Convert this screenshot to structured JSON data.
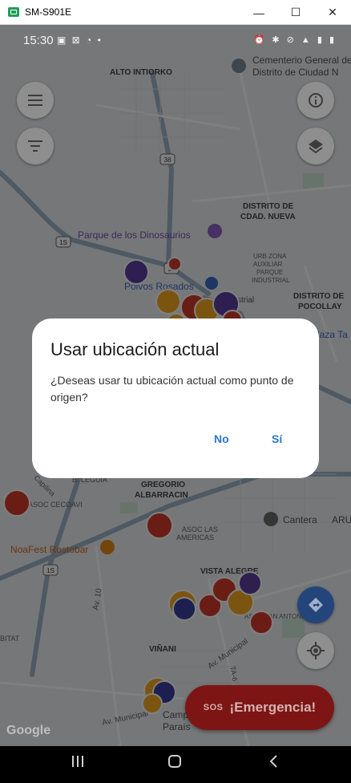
{
  "window": {
    "title": "SM-S901E",
    "minimize": "—",
    "maximize": "☐",
    "close": "✕"
  },
  "status_bar": {
    "time": "15:30",
    "left_icons": "▣ ⊠ ◔ •",
    "right_icons": "⏰ ✱ ⊘ ▲ ▮ ▮"
  },
  "map_labels": {
    "cementerio": "Cementerio General de",
    "cementerio2": "Distrito de Ciudad N",
    "alto_intiorko": "ALTO INTIORKO",
    "distrito_cdad_nueva1": "DISTRITO DE",
    "distrito_cdad_nueva2": "CDAD. NUEVA",
    "parque": "Parque de los Dinosaurios",
    "polvos_rosados": "Polvos Rosados",
    "urb1": "URB ZONA",
    "urb2": "AUXILIAR",
    "urb3": "PARQUE",
    "urb4": "INDUSTRIAL",
    "pocollay1": "DISTRITO DE",
    "pocollay2": "POCOLLAY",
    "plaza": "laza Ta",
    "striar": "strial",
    "gregorio1": "GREGORIO",
    "gregorio2": "ALBARRACIN",
    "cantera": "Cantera",
    "aru": "ARU",
    "asoc_cecoavi": "ASOC CECOAVI",
    "capilina": "Capilina",
    "leguia": "B. LEGUIA",
    "asoc_americas1": "ASOC LAS",
    "asoc_americas2": "AMERICAS",
    "noafest": "NoaFest Restobar",
    "vista_alegre": "VISTA ALEGRE",
    "asoc_san_antonio": "ASOC SAN ANTONIO",
    "av10": "Av. 10",
    "vinani": "VIÑANI",
    "av_municipal": "Av. Municipal",
    "av_municipal2": "Av. Municipal",
    "ta6": "TA-6",
    "bitat": "BITAT",
    "campo1": "Camp",
    "campo2": "Paraís",
    "ruta38": "38",
    "ruta38b": "38",
    "ruta1s": "1S",
    "ruta1sb": "1S",
    "google": "Google"
  },
  "controls": {
    "emergency_label": "¡Emergencia!",
    "emergency_sos": "SOS"
  },
  "dialog": {
    "title": "Usar ubicación actual",
    "body": "¿Deseas usar tu ubicación actual como punto de origen?",
    "no_label": "No",
    "yes_label": "Sí"
  },
  "colors": {
    "dialog_button": "#2c77c8",
    "emergency": "#c62828",
    "marker_orange": "#f6a821",
    "marker_red": "#d43b2b",
    "marker_purple": "#5c3fa0"
  }
}
